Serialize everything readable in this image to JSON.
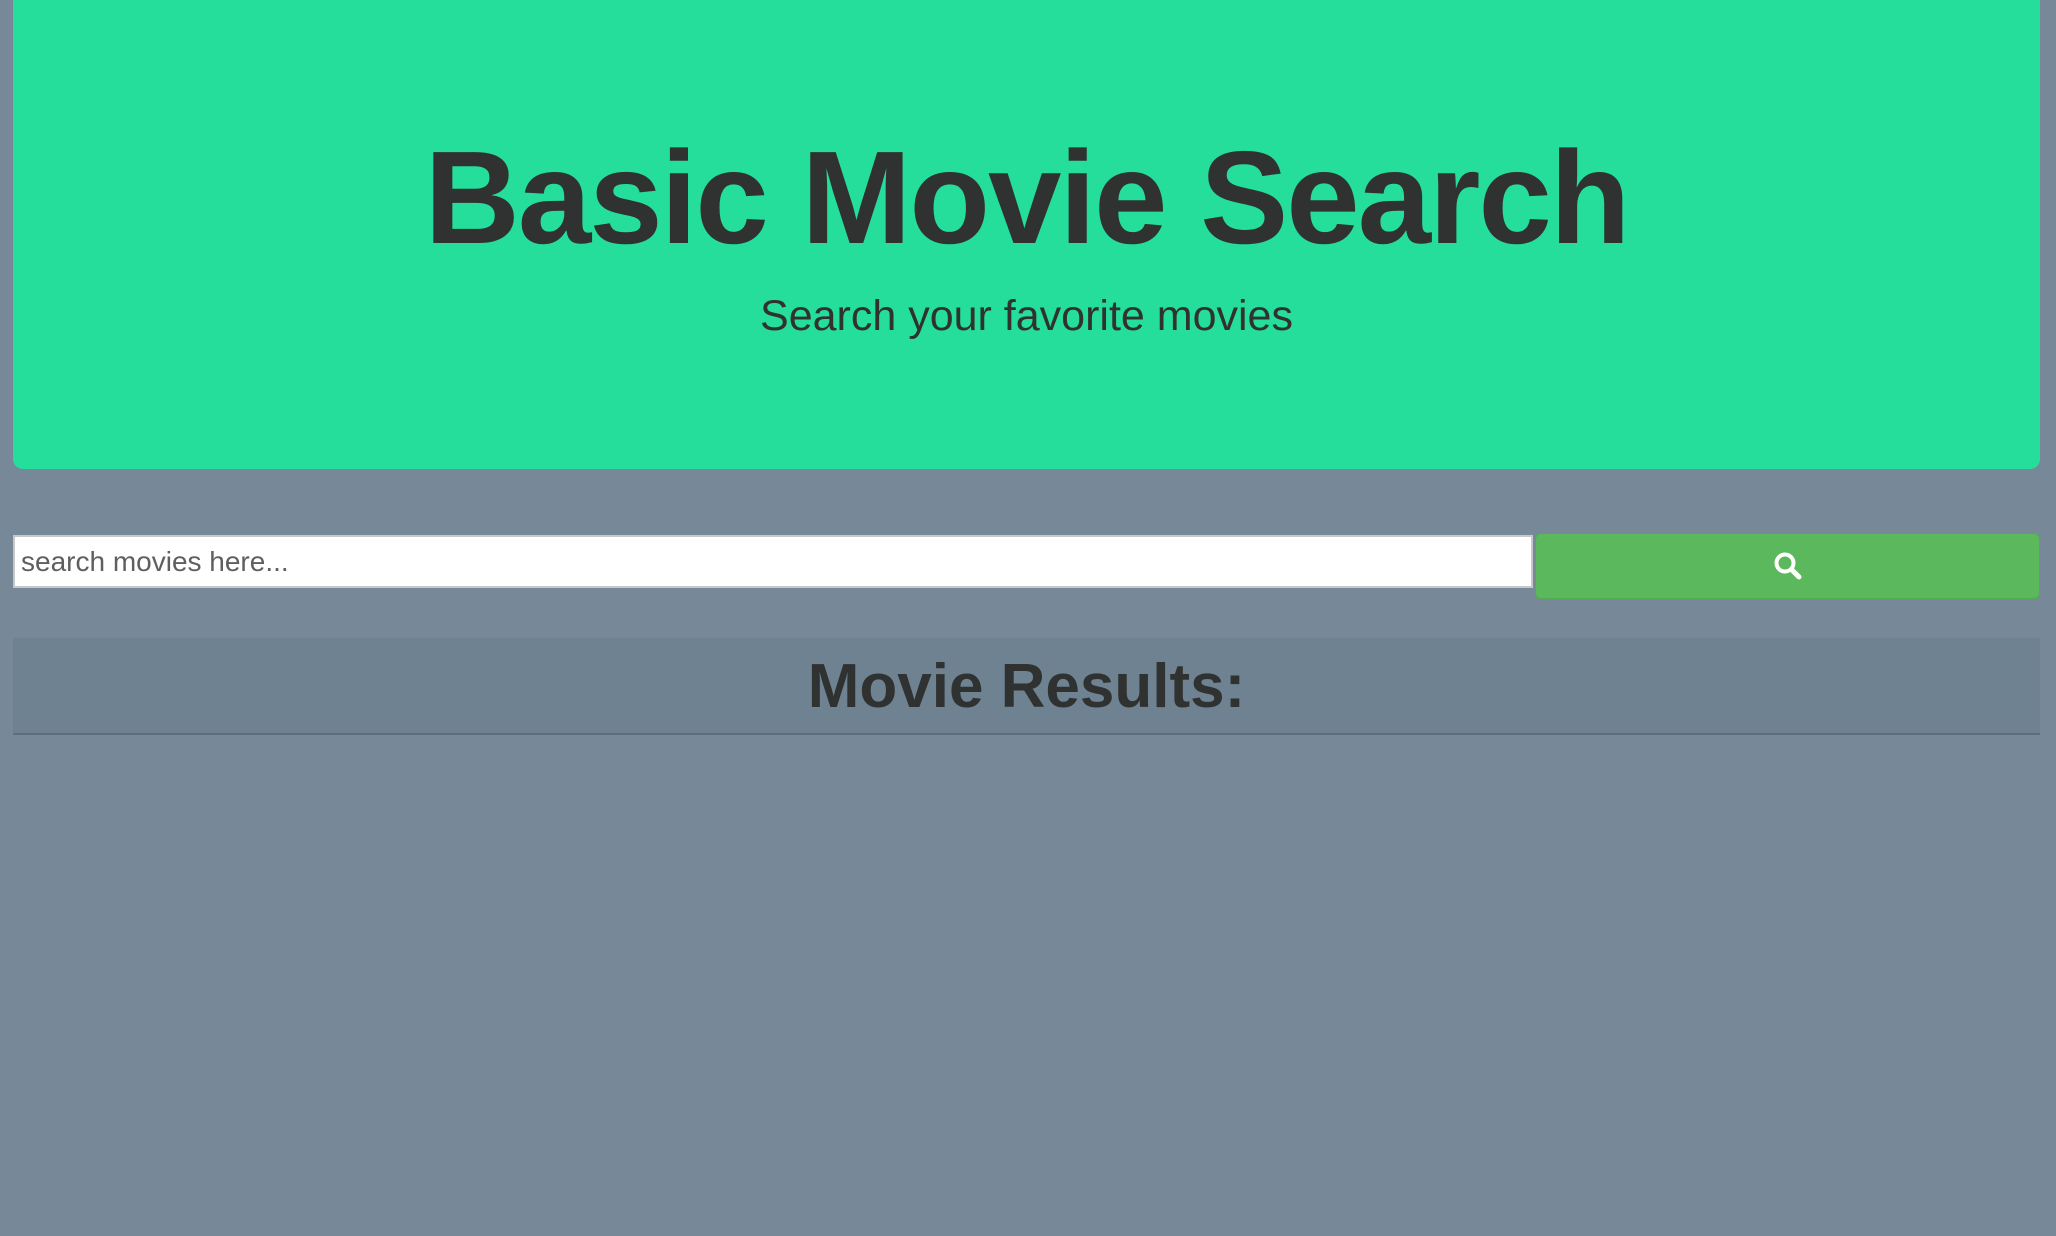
{
  "hero": {
    "title": "Basic Movie Search",
    "subtitle": "Search your favorite movies"
  },
  "search": {
    "placeholder": "search movies here...",
    "value": "",
    "button_icon": "search-icon"
  },
  "results": {
    "heading": "Movie Results:",
    "items": []
  },
  "colors": {
    "background": "#778899",
    "hero": "#25de9c",
    "button": "#5cb85c",
    "text": "#2f3230"
  }
}
